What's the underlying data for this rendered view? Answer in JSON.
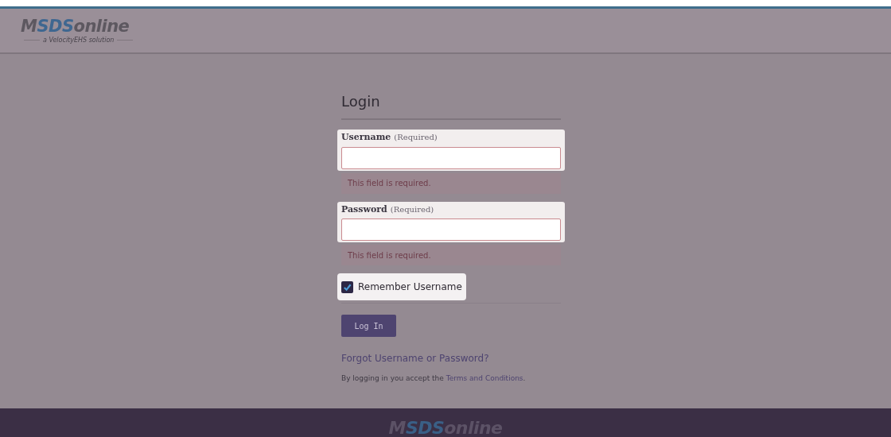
{
  "header": {
    "logo": [
      {
        "text": "M",
        "accent": false
      },
      {
        "text": "SDS",
        "accent": true
      },
      {
        "text": "online",
        "accent": false
      }
    ],
    "tagline": "a VelocityEHS solution"
  },
  "form": {
    "title": "Login",
    "fields": [
      {
        "label": "Username",
        "hint": "(Required)",
        "invalid": true,
        "error": "This field is required."
      },
      {
        "label": "Password",
        "hint": "(Required)",
        "invalid": true,
        "error": "This field is required."
      }
    ],
    "remember": {
      "label": "Remember Username",
      "checked": true
    },
    "submit": "Log In",
    "forgot_link": "Forgot Username or Password?",
    "terms": {
      "text": "By logging in you accept the",
      "link": "Terms and Conditions",
      "end": "."
    }
  },
  "footer": {
    "logo": [
      {
        "text": "M",
        "accent": false
      },
      {
        "text": "SDS",
        "accent": true
      },
      {
        "text": "online",
        "accent": false
      }
    ]
  }
}
